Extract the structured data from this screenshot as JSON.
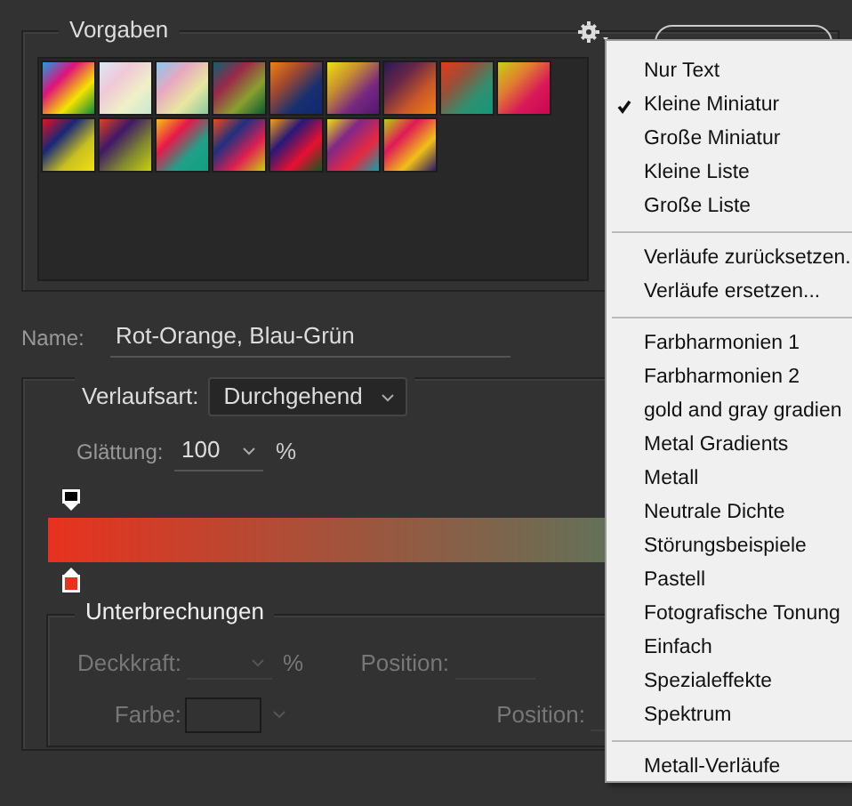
{
  "presets": {
    "title": "Vorgaben"
  },
  "name": {
    "label": "Name:",
    "value": "Rot-Orange, Blau-Grün"
  },
  "gradient": {
    "type_label": "Verlaufsart:",
    "type_value": "Durchgehend",
    "smoothing_label": "Glättung:",
    "smoothing_value": "100",
    "smoothing_unit": "%"
  },
  "stops": {
    "title": "Unterbrechungen",
    "opacity_label": "Deckkraft:",
    "opacity_unit": "%",
    "color_label": "Farbe:",
    "position_label_1": "Position:",
    "position_label_2": "Position:"
  },
  "menu": {
    "sections": [
      [
        {
          "label": "Nur Text",
          "checked": false
        },
        {
          "label": "Kleine Miniatur",
          "checked": true
        },
        {
          "label": "Große Miniatur",
          "checked": false
        },
        {
          "label": "Kleine Liste",
          "checked": false
        },
        {
          "label": "Große Liste",
          "checked": false
        }
      ],
      [
        {
          "label": "Verläufe zurücksetzen.",
          "checked": false
        },
        {
          "label": "Verläufe ersetzen...",
          "checked": false
        }
      ],
      [
        {
          "label": "Farbharmonien 1",
          "checked": false
        },
        {
          "label": "Farbharmonien 2",
          "checked": false
        },
        {
          "label": "gold and gray gradien",
          "checked": false
        },
        {
          "label": "Metal Gradients",
          "checked": false
        },
        {
          "label": "Metall",
          "checked": false
        },
        {
          "label": "Neutrale Dichte",
          "checked": false
        },
        {
          "label": "Störungsbeispiele",
          "checked": false
        },
        {
          "label": "Pastell",
          "checked": false
        },
        {
          "label": "Fotografische Tonung",
          "checked": false
        },
        {
          "label": "Einfach",
          "checked": false
        },
        {
          "label": "Spezialeffekte",
          "checked": false
        },
        {
          "label": "Spektrum",
          "checked": false
        }
      ],
      [
        {
          "label": "Metall-Verläufe",
          "checked": false
        }
      ]
    ]
  }
}
